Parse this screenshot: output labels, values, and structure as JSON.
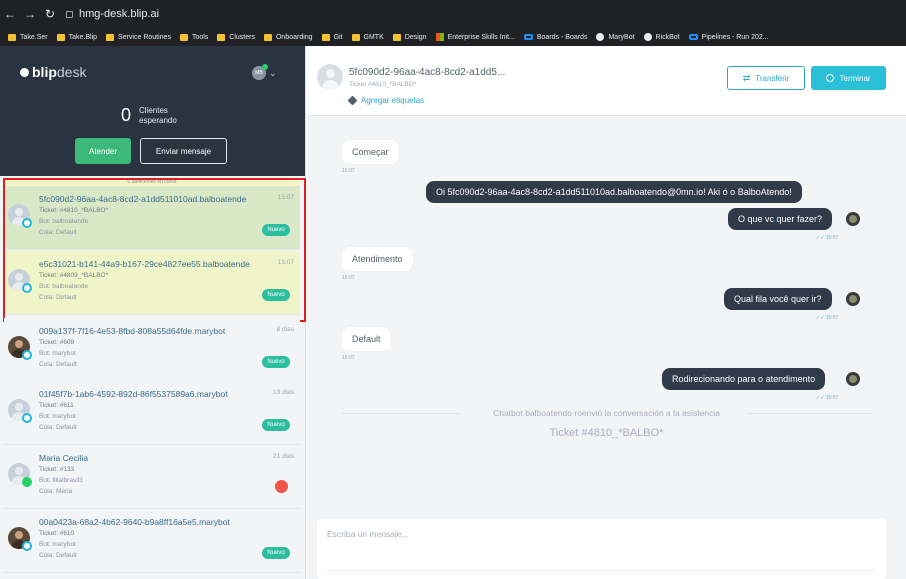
{
  "browser": {
    "url": "hmg-desk.blip.ai",
    "bookmarks": [
      "Take.Ser",
      "Take.Blip",
      "Service Routines",
      "Tools",
      "Clusters",
      "Onboarding",
      "Git",
      "GMTK",
      "Design",
      "Enterprise Skills Init...",
      "Boards - Boards",
      "MaryBot",
      "RickBot",
      "Pipelines - Run 202..."
    ]
  },
  "sidebar": {
    "logo_bold": "blip",
    "logo_light": "desk",
    "agent_initials": "MB",
    "waiting_count": "0",
    "waiting_label": "Clientes esperando",
    "btn_attend": "Atender",
    "btn_send": "Enviar mensaje",
    "in_progress": "0 atenciones en curso",
    "tickets": [
      {
        "id": "5fc090d2-96aa-4ac8-8cd2-a1dd511010ad.balboatende",
        "ticket": "Ticket: #4810_*BALBO*",
        "bot": "Bot: balboatende",
        "queue": "Cola: Default",
        "time": "15:07",
        "badge": "Nuevo"
      },
      {
        "id": "e5c31021-b141-44a9-b167-29ce4827ee55.balboatende",
        "ticket": "Ticket: #4809_*BALBO*",
        "bot": "Bot: balboatende",
        "queue": "Cola: Default",
        "time": "15:07",
        "badge": "Nuevo"
      },
      {
        "id": "009a137f-7f16-4e53-8fbd-808a55d64fde.marybot",
        "ticket": "Ticket: #609",
        "bot": "Bot: marybot",
        "queue": "Cola: Default",
        "time": "8 dias",
        "badge": "Nuevo"
      },
      {
        "id": "01f45f7b-1ab6-4592-892d-86f5537589a6.marybot",
        "ticket": "Ticket: #611",
        "bot": "Bot: marybot",
        "queue": "Cola: Default",
        "time": "13 dias",
        "badge": "Nuevo"
      },
      {
        "id": "Maria Cecilia",
        "ticket": "Ticket: #133",
        "bot": "Bot: filialbrasil3",
        "queue": "Cola: Maria",
        "time": "21 dias",
        "badge": ""
      },
      {
        "id": "00a0423a-68a2-4b62-9640-b9a8ff16a5e5.marybot",
        "ticket": "Ticket: #610",
        "bot": "Bot: marybot",
        "queue": "Cola: Default",
        "time": "",
        "badge": "Nuevo"
      }
    ]
  },
  "header": {
    "title": "5fc090d2-96aa-4ac8-8cd2-a1dd5...",
    "subtitle": "Ticket #4810_*BALBO*",
    "tags_link": "Agregar etiquetas",
    "btn_transfer": "Transferir",
    "btn_end": "Terminar"
  },
  "chat": {
    "messages": [
      {
        "text": "Começar",
        "time": "15:07"
      },
      {
        "text": "Oi 5fc090d2-96aa-4ac8-8cd2-a1dd511010ad.balboatendo@0mn.io! Aki ó o BalboAtendo!"
      },
      {
        "text": "O que vc quer fazer?",
        "time": "15:07"
      },
      {
        "text": "Atendimento",
        "time": "15:07"
      },
      {
        "text": "Qual fila você quer ir?",
        "time": "15:07"
      },
      {
        "text": "Default",
        "time": "15:07"
      },
      {
        "text": "Rodirecionando para o atendimento",
        "time": "15:07"
      }
    ],
    "system_text": "Chatbot balboatendo roenvió la conversación a la asistencia",
    "system_ticket": "Ticket #4810_*BALBO*",
    "composer_placeholder": "Escriba un mensaje..."
  }
}
